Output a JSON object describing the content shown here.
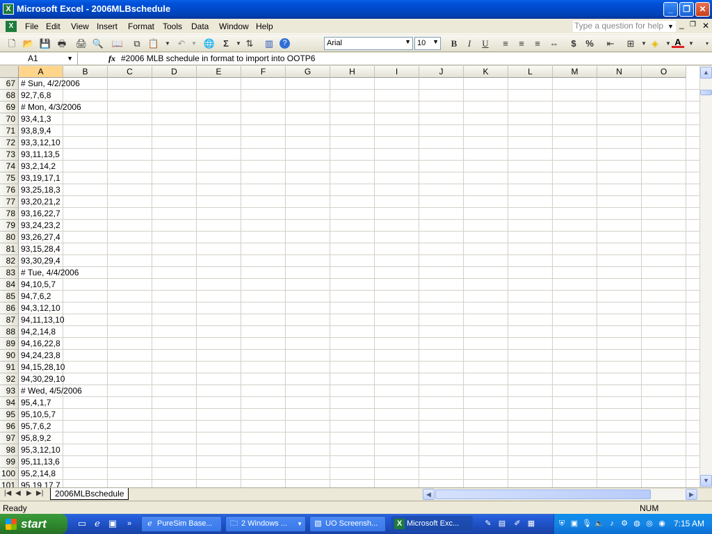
{
  "window": {
    "title": "Microsoft Excel - 2006MLBschedule"
  },
  "menu": {
    "items": [
      "File",
      "Edit",
      "View",
      "Insert",
      "Format",
      "Tools",
      "Data",
      "Window",
      "Help"
    ],
    "help_placeholder": "Type a question for help"
  },
  "toolbar": {
    "font": "Arial",
    "size": "10",
    "bold": "B",
    "italic": "I",
    "underline": "U",
    "currency": "$",
    "percent": "%",
    "sum": "Σ"
  },
  "formula_bar": {
    "name_box": "A1",
    "fx": "fx",
    "content": "#2006 MLB schedule in format to import into OOTP6"
  },
  "grid": {
    "columns": [
      "A",
      "B",
      "C",
      "D",
      "E",
      "F",
      "G",
      "H",
      "I",
      "J",
      "K",
      "L",
      "M",
      "N",
      "O"
    ],
    "rows": [
      [
        "67",
        "# Sun, 4/2/2006"
      ],
      [
        "68",
        "92,7,6,8"
      ],
      [
        "69",
        "# Mon, 4/3/2006"
      ],
      [
        "70",
        "93,4,1,3"
      ],
      [
        "71",
        "93,8,9,4"
      ],
      [
        "72",
        "93,3,12,10"
      ],
      [
        "73",
        "93,11,13,5"
      ],
      [
        "74",
        "93,2,14,2"
      ],
      [
        "75",
        "93,19,17,1"
      ],
      [
        "76",
        "93,25,18,3"
      ],
      [
        "77",
        "93,20,21,2"
      ],
      [
        "78",
        "93,16,22,7"
      ],
      [
        "79",
        "93,24,23,2"
      ],
      [
        "80",
        "93,26,27,4"
      ],
      [
        "81",
        "93,15,28,4"
      ],
      [
        "82",
        "93,30,29,4"
      ],
      [
        "83",
        "# Tue, 4/4/2006"
      ],
      [
        "84",
        "94,10,5,7"
      ],
      [
        "85",
        "94,7,6,2"
      ],
      [
        "86",
        "94,3,12,10"
      ],
      [
        "87",
        "94,11,13,10"
      ],
      [
        "88",
        "94,2,14,8"
      ],
      [
        "89",
        "94,16,22,8"
      ],
      [
        "90",
        "94,24,23,8"
      ],
      [
        "91",
        "94,15,28,10"
      ],
      [
        "92",
        "94,30,29,10"
      ],
      [
        "93",
        "# Wed, 4/5/2006"
      ],
      [
        "94",
        "95,4,1,7"
      ],
      [
        "95",
        "95,10,5,7"
      ],
      [
        "96",
        "95,7,6,2"
      ],
      [
        "97",
        "95,8,9,2"
      ],
      [
        "98",
        "95,3,12,10"
      ],
      [
        "99",
        "95,11,13,6"
      ],
      [
        "100",
        "95,2,14,8"
      ],
      [
        "101",
        "95,19,17,7"
      ]
    ]
  },
  "sheet_tab": "2006MLBschedule",
  "status": {
    "left": "Ready",
    "num": "NUM"
  },
  "taskbar": {
    "start": "start",
    "tasks": [
      "PureSim Base...",
      "2 Windows ...",
      "UO Screensh...",
      "Microsoft Exc..."
    ],
    "clock": "7:15 AM"
  }
}
